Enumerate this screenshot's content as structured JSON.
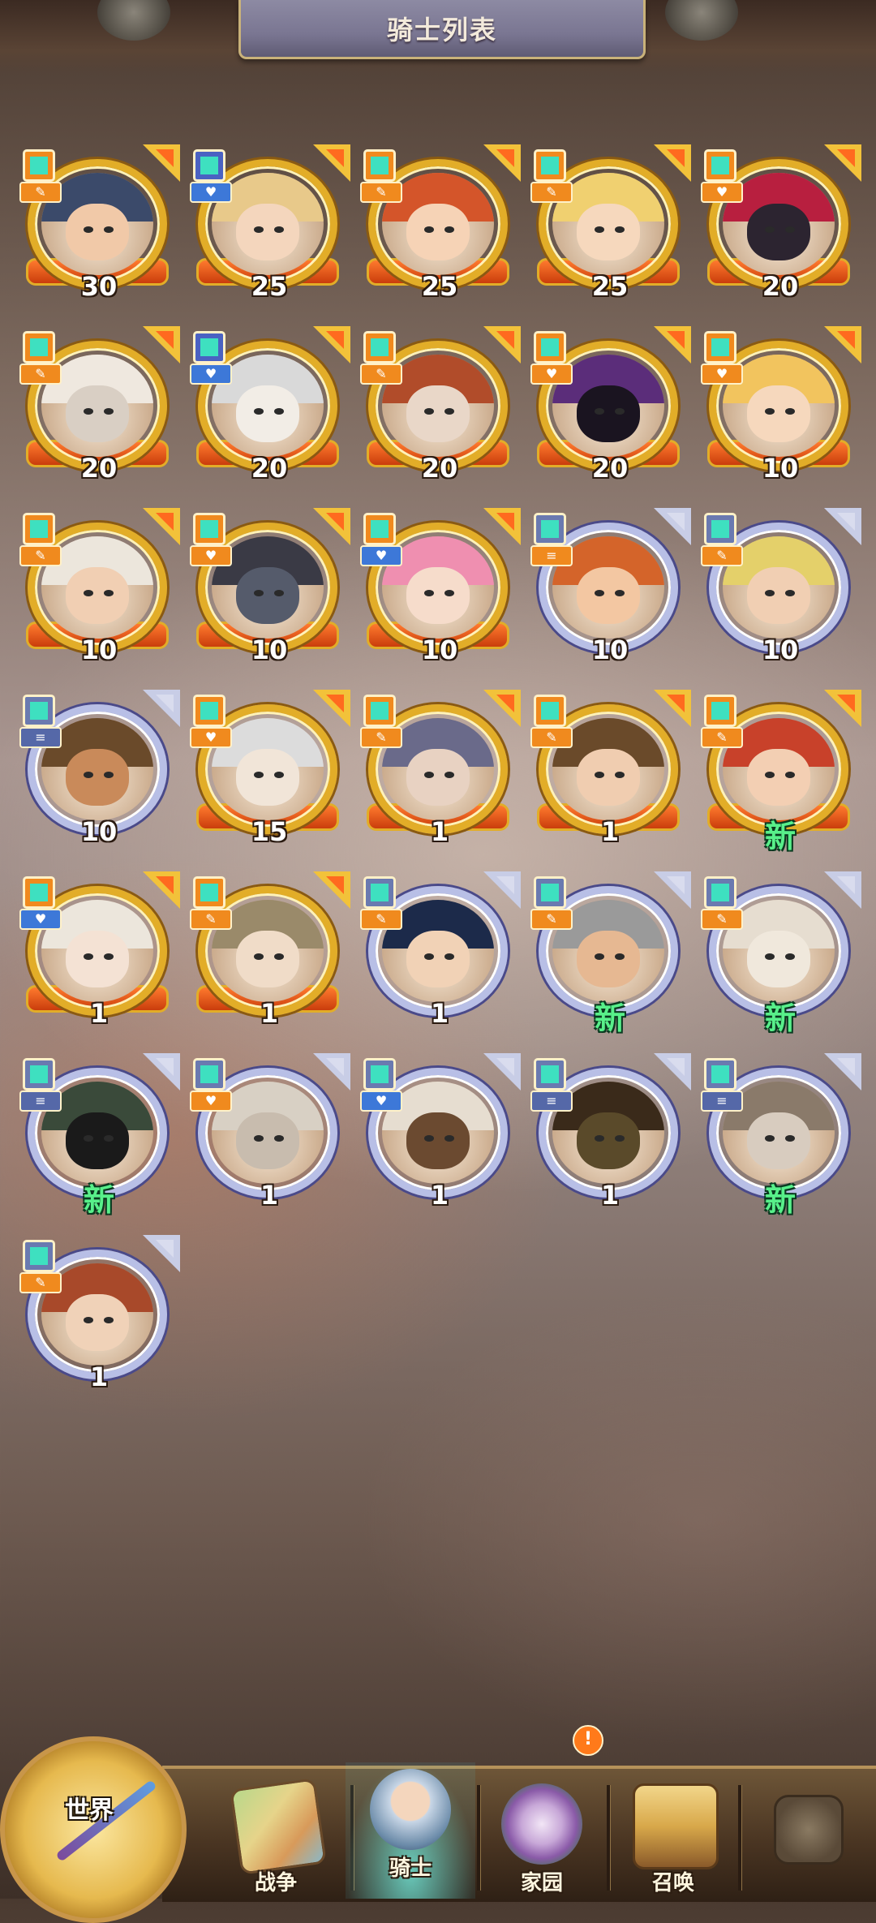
{
  "header": {
    "title": "骑士列表"
  },
  "knights": [
    {
      "level": "30",
      "frame": "gold",
      "hair": "#3b4a6a",
      "skin": "#f1c9a8",
      "badge": "orange",
      "role": "orange",
      "role_glyph": "✎"
    },
    {
      "level": "25",
      "frame": "gold",
      "hair": "#e8c98a",
      "skin": "#f4d6bd",
      "badge": "blue",
      "role": "blue",
      "role_glyph": "♥"
    },
    {
      "level": "25",
      "frame": "gold",
      "hair": "#d4552a",
      "skin": "#f6d3b6",
      "badge": "orange",
      "role": "orange",
      "role_glyph": "✎"
    },
    {
      "level": "25",
      "frame": "gold",
      "hair": "#f0d070",
      "skin": "#f6d8bd",
      "badge": "orange",
      "role": "orange",
      "role_glyph": "✎"
    },
    {
      "level": "20",
      "frame": "gold",
      "hair": "#b81f3f",
      "skin": "#2c2430",
      "badge": "orange",
      "role": "orange",
      "role_glyph": "♥"
    },
    {
      "level": "20",
      "frame": "gold",
      "hair": "#efe8df",
      "skin": "#d9cfc4",
      "badge": "orange",
      "role": "orange",
      "role_glyph": "✎"
    },
    {
      "level": "20",
      "frame": "gold",
      "hair": "#d9d9d9",
      "skin": "#f2ede6",
      "badge": "blue",
      "role": "blue",
      "role_glyph": "♥"
    },
    {
      "level": "20",
      "frame": "gold",
      "hair": "#b14c2a",
      "skin": "#e9d7c8",
      "badge": "orange",
      "role": "orange",
      "role_glyph": "✎"
    },
    {
      "level": "20",
      "frame": "gold",
      "hair": "#5b2d7a",
      "skin": "#1a1420",
      "badge": "orange",
      "role": "orange",
      "role_glyph": "♥"
    },
    {
      "level": "10",
      "frame": "gold",
      "hair": "#f2c45e",
      "skin": "#f6d8bd",
      "badge": "orange",
      "role": "orange",
      "role_glyph": "♥"
    },
    {
      "level": "10",
      "frame": "gold",
      "hair": "#ece6dc",
      "skin": "#f1cfb3",
      "badge": "orange",
      "role": "orange",
      "role_glyph": "✎"
    },
    {
      "level": "10",
      "frame": "gold",
      "hair": "#3a3a45",
      "skin": "#555b6b",
      "badge": "orange",
      "role": "orange",
      "role_glyph": "♥"
    },
    {
      "level": "10",
      "frame": "gold",
      "hair": "#ef8fb0",
      "skin": "#f6dccb",
      "badge": "orange",
      "role": "blue",
      "role_glyph": "♥"
    },
    {
      "level": "10",
      "frame": "silver",
      "hair": "#d4642a",
      "skin": "#f3c7a2",
      "badge": "gray",
      "role": "orange",
      "role_glyph": "≡"
    },
    {
      "level": "10",
      "frame": "silver",
      "hair": "#e4d06a",
      "skin": "#f1cfb3",
      "badge": "gray",
      "role": "orange",
      "role_glyph": "✎"
    },
    {
      "level": "10",
      "frame": "silver",
      "hair": "#6a4a2a",
      "skin": "#c98a5a",
      "badge": "gray",
      "role": "gray",
      "role_glyph": "≡"
    },
    {
      "level": "15",
      "frame": "gold",
      "hair": "#dcdcdc",
      "skin": "#f1e5d8",
      "badge": "orange",
      "role": "orange",
      "role_glyph": "♥"
    },
    {
      "level": "1",
      "frame": "gold",
      "hair": "#6a6a8a",
      "skin": "#e8d2c2",
      "badge": "orange",
      "role": "orange",
      "role_glyph": "✎"
    },
    {
      "level": "1",
      "frame": "gold",
      "hair": "#6a4a2a",
      "skin": "#f0cdb0",
      "badge": "orange",
      "role": "orange",
      "role_glyph": "✎"
    },
    {
      "level": "新",
      "frame": "gold",
      "hair": "#c8412a",
      "skin": "#f3cfb3",
      "badge": "orange",
      "role": "orange",
      "role_glyph": "✎"
    },
    {
      "level": "1",
      "frame": "gold",
      "hair": "#ece6dc",
      "skin": "#f4e2d4",
      "badge": "orange",
      "role": "blue",
      "role_glyph": "♥"
    },
    {
      "level": "1",
      "frame": "gold",
      "hair": "#9a8a6a",
      "skin": "#f0dcc8",
      "badge": "orange",
      "role": "orange",
      "role_glyph": "✎"
    },
    {
      "level": "1",
      "frame": "silver",
      "hair": "#1c2a4a",
      "skin": "#f1d2b6",
      "badge": "gray",
      "role": "orange",
      "role_glyph": "✎"
    },
    {
      "level": "新",
      "frame": "silver",
      "hair": "#9a9a9a",
      "skin": "#e6b892",
      "badge": "gray",
      "role": "orange",
      "role_glyph": "✎"
    },
    {
      "level": "新",
      "frame": "silver",
      "hair": "#e6ddd0",
      "skin": "#f0e8dc",
      "badge": "gray",
      "role": "orange",
      "role_glyph": "✎"
    },
    {
      "level": "新",
      "frame": "silver",
      "hair": "#3a4a3a",
      "skin": "#1a1a1a",
      "badge": "gray",
      "role": "gray",
      "role_glyph": "≡"
    },
    {
      "level": "1",
      "frame": "silver",
      "hair": "#d8d0c4",
      "skin": "#c8bcae",
      "badge": "gray",
      "role": "orange",
      "role_glyph": "♥"
    },
    {
      "level": "1",
      "frame": "silver",
      "hair": "#e6ddd0",
      "skin": "#6b4a30",
      "badge": "gray",
      "role": "blue",
      "role_glyph": "♥"
    },
    {
      "level": "1",
      "frame": "silver",
      "hair": "#3a2a1a",
      "skin": "#5a4a2a",
      "badge": "gray",
      "role": "gray",
      "role_glyph": "≡"
    },
    {
      "level": "新",
      "frame": "silver",
      "hair": "#8a7a6a",
      "skin": "#d8ccbf",
      "badge": "gray",
      "role": "gray",
      "role_glyph": "≡"
    },
    {
      "level": "1",
      "frame": "silver",
      "hair": "#a8492a",
      "skin": "#f0d2b8",
      "badge": "gray",
      "role": "orange",
      "role_glyph": "✎"
    }
  ],
  "nav": {
    "world": "世界",
    "war": "战争",
    "knights": "骑士",
    "home": "家园",
    "summon": "召唤",
    "home_alert": "!"
  },
  "icons": {
    "war": "map-icon",
    "knights": "knight-portrait-icon",
    "home": "gear-castle-icon",
    "summon": "chest-icon",
    "locked": "lock-icon",
    "world": "compass-icon"
  },
  "colors": {
    "gold_frame": "#e2ad28",
    "silver_frame": "#b8bfe6",
    "new_text": "#58f08a",
    "accent_orange": "#f08a1e"
  }
}
